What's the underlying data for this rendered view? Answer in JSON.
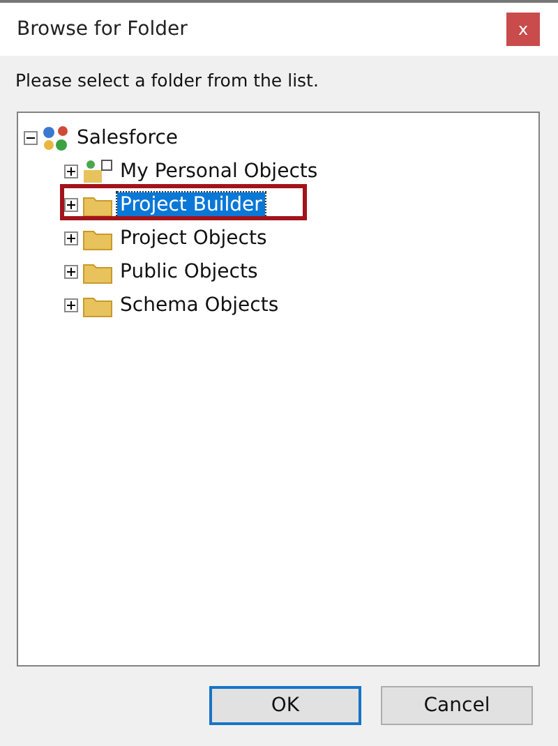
{
  "window": {
    "title": "Browse for Folder",
    "close": "x"
  },
  "prompt": "Please select a folder from the list.",
  "tree": [
    {
      "label": "Salesforce",
      "kind": "network",
      "expanded": true,
      "selected": false,
      "highlighted": false,
      "children": [
        {
          "label": "My Personal Objects",
          "kind": "personal",
          "expanded": false,
          "selected": false,
          "highlighted": false
        },
        {
          "label": "Project Builder",
          "kind": "folder",
          "expanded": false,
          "selected": true,
          "highlighted": true
        },
        {
          "label": "Project Objects",
          "kind": "folder",
          "expanded": false,
          "selected": false,
          "highlighted": false
        },
        {
          "label": "Public Objects",
          "kind": "folder",
          "expanded": false,
          "selected": false,
          "highlighted": false
        },
        {
          "label": "Schema Objects",
          "kind": "folder",
          "expanded": false,
          "selected": false,
          "highlighted": false
        }
      ]
    }
  ],
  "buttons": [
    {
      "label": "OK",
      "default": true
    },
    {
      "label": "Cancel",
      "default": false
    }
  ]
}
